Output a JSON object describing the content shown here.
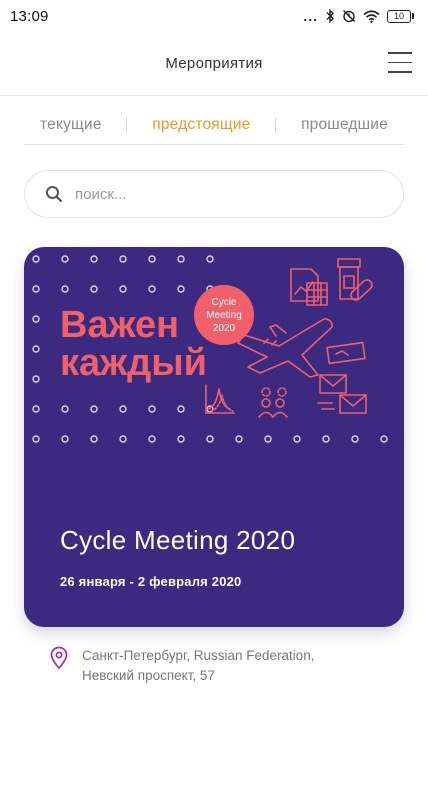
{
  "status_bar": {
    "time": "13:09",
    "dots": "...",
    "battery": "10"
  },
  "header": {
    "title": "Мероприятия"
  },
  "tabs": [
    {
      "label": "текущие",
      "active": false
    },
    {
      "label": "предстоящие",
      "active": true
    },
    {
      "label": "прошедшие",
      "active": false
    }
  ],
  "search": {
    "placeholder": "поиск..."
  },
  "event": {
    "title": "Cycle Meeting 2020",
    "dates": "26 января - 2 февраля 2020",
    "banner_heading_line1": "Важен",
    "banner_heading_line2": "каждый",
    "badge_line1": "Cycle",
    "badge_line2": "Meeting",
    "badge_line3": "2020",
    "address_line1": "Санкт-Петербург, Russian Federation,",
    "address_line2": "Невский проспект, 57"
  },
  "colors": {
    "accent": "#e79b2b",
    "card_background": "#3c2a80",
    "banner_coral": "#f0606a",
    "location_pin": "#a23a8a"
  }
}
